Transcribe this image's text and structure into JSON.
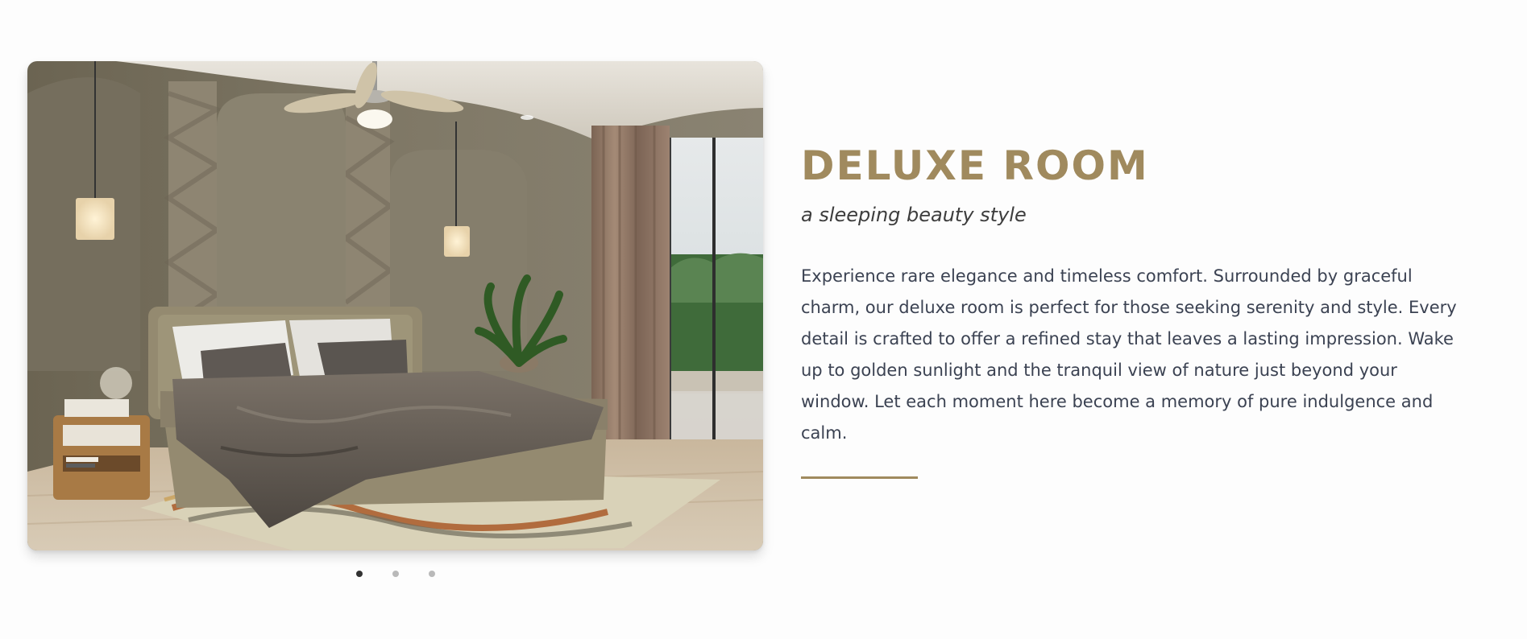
{
  "room": {
    "title": "DELUXE ROOM",
    "subtitle": "a sleeping beauty style",
    "description": "Experience rare elegance and timeless comfort. Surrounded by graceful charm, our deluxe room is perfect for those seeking serenity and style. Every detail is crafted to offer a refined stay that leaves a lasting impression. Wake up to golden sunlight and the tranquil view of nature just beyond your window. Let each moment here become a memory of pure indulgence and calm."
  },
  "carousel": {
    "slide_count": 3,
    "active_slide": 1
  },
  "colors": {
    "accent": "#a08a5e",
    "heading": "#a08a5e",
    "body_text": "#3b4252",
    "dot_active": "#333333",
    "dot_inactive": "#b9b9b9"
  }
}
